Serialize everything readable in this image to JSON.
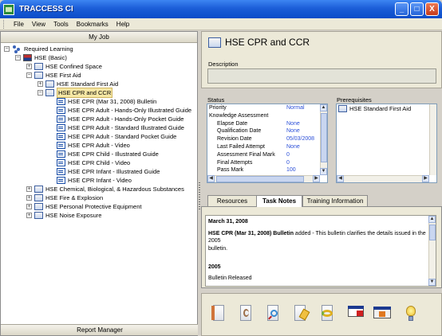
{
  "window": {
    "title": "TRACCESS CI",
    "minimize": "_",
    "maximize": "□",
    "close": "X"
  },
  "menu": [
    "File",
    "View",
    "Tools",
    "Bookmarks",
    "Help"
  ],
  "left_panel": {
    "header": "My Job",
    "footer": "Report Manager",
    "tree": [
      {
        "label": "Required Learning",
        "indent": 0,
        "expander": "−",
        "icon": "people-icon"
      },
      {
        "label": "HSE (Basic)",
        "indent": 1,
        "expander": "−",
        "icon": "flag-icon"
      },
      {
        "label": "HSE  Confined Space",
        "indent": 2,
        "expander": "+",
        "icon": "course-icon"
      },
      {
        "label": "HSE  First Aid",
        "indent": 2,
        "expander": "−",
        "icon": "course-icon"
      },
      {
        "label": "HSE  Standard First Aid",
        "indent": 3,
        "expander": "+",
        "icon": "course-icon"
      },
      {
        "label": "HSE  CPR and CCR",
        "indent": 3,
        "expander": "−",
        "icon": "course-icon",
        "selected": true
      },
      {
        "label": "HSE  CPR (Mar 31, 2008) Bulletin",
        "indent": 4,
        "expander": "",
        "icon": "document-icon"
      },
      {
        "label": "HSE  CPR Adult - Hands-Only Illustrated Guide",
        "indent": 4,
        "expander": "",
        "icon": "document-icon"
      },
      {
        "label": "HSE  CPR Adult - Hands-Only Pocket Guide",
        "indent": 4,
        "expander": "",
        "icon": "document-icon"
      },
      {
        "label": "HSE  CPR Adult - Standard Illustrated Guide",
        "indent": 4,
        "expander": "",
        "icon": "document-icon"
      },
      {
        "label": "HSE  CPR Adult - Standard Pocket Guide",
        "indent": 4,
        "expander": "",
        "icon": "document-icon"
      },
      {
        "label": "HSE  CPR Adult - Video",
        "indent": 4,
        "expander": "",
        "icon": "document-icon"
      },
      {
        "label": "HSE  CPR Child - Illustrated Guide",
        "indent": 4,
        "expander": "",
        "icon": "document-icon"
      },
      {
        "label": "HSE  CPR Child - Video",
        "indent": 4,
        "expander": "",
        "icon": "document-icon"
      },
      {
        "label": "HSE  CPR Infant - Illustrated Guide",
        "indent": 4,
        "expander": "",
        "icon": "document-icon"
      },
      {
        "label": "HSE  CPR Infant - Video",
        "indent": 4,
        "expander": "",
        "icon": "document-icon"
      },
      {
        "label": "HSE  Chemical, Biological, & Hazardous Substances",
        "indent": 2,
        "expander": "+",
        "icon": "course-icon"
      },
      {
        "label": "HSE  Fire & Explosion",
        "indent": 2,
        "expander": "+",
        "icon": "course-icon"
      },
      {
        "label": "HSE  Personal Protective Equipment",
        "indent": 2,
        "expander": "+",
        "icon": "course-icon"
      },
      {
        "label": "HSE  Noise Exposure",
        "indent": 2,
        "expander": "+",
        "icon": "course-icon"
      }
    ]
  },
  "detail": {
    "title": "HSE  CPR and CCR",
    "description_label": "Description",
    "description_value": "",
    "status_label": "Status",
    "status_rows": [
      {
        "key": "Priority",
        "value": "Normal",
        "sub": false
      },
      {
        "key": "Knowledge Assessment",
        "value": "",
        "sub": false
      },
      {
        "key": "Elapse Date",
        "value": "None",
        "sub": true
      },
      {
        "key": "Qualification Date",
        "value": "None",
        "sub": true
      },
      {
        "key": "Revision Date",
        "value": "05/03/2008",
        "sub": true
      },
      {
        "key": "Last Failed Attempt",
        "value": "None",
        "sub": true
      },
      {
        "key": "Assessment Final Mark",
        "value": "0",
        "sub": true
      },
      {
        "key": "Final Attempts",
        "value": "0",
        "sub": true
      },
      {
        "key": "Pass Mark",
        "value": "100",
        "sub": true
      }
    ],
    "prereq_label": "Prerequisites",
    "prereqs": [
      "HSE  Standard First Aid"
    ]
  },
  "tabs": [
    "Resources",
    "Task Notes",
    "Training Information"
  ],
  "active_tab": "Task Notes",
  "notes": {
    "date1": "March 31, 2008",
    "bulletin_bold": "HSE  CPR (Mar 31, 2008) Bulletin",
    "bulletin_text": " added - This bulletin clarifies the details issued in the 2005",
    "bulletin_text2": "bulletin.",
    "year": "2005",
    "released": "Bulletin Released"
  },
  "toolbar_icons": [
    "document-icon",
    "ear-icon",
    "magnifier-icon",
    "checklist-icon",
    "refresh-icon",
    "presentation-icon",
    "video-icon",
    "lightbulb-icon"
  ],
  "colors": {
    "titlebar": "#1c5ed8",
    "link_value": "#2b4fd8",
    "selection": "#f6e7a4"
  }
}
